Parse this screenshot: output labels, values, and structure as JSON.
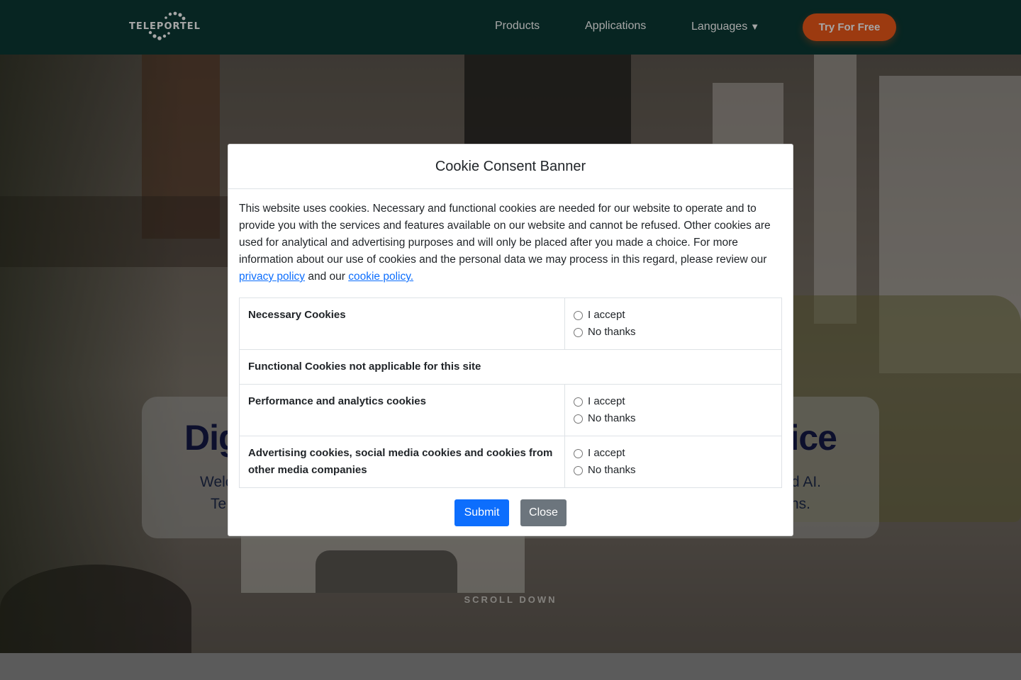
{
  "header": {
    "logo_text": "TELEPORTEL",
    "nav": {
      "products": "Products",
      "applications": "Applications",
      "languages": "Languages",
      "languages_caret": "▼"
    },
    "cta": "Try For Free"
  },
  "hero": {
    "title_left": "Dig",
    "title_right": "ice",
    "line1_left": "Welc",
    "line1_right": "d AI.",
    "line2_left": "Te",
    "line2_right": "ns.",
    "scroll_text": "SCROLL DOWN"
  },
  "modal": {
    "title": "Cookie Consent Banner",
    "intro_text": "This website uses cookies. Necessary and functional cookies are needed for our website to operate and to provide you with the services and features available on our website and cannot be refused. Other cookies are used for analytical and advertising purposes and will only be placed after you made a choice. For more information about our use of cookies and the personal data we may process in this regard, please review our ",
    "privacy_link": "privacy policy",
    "and_text": " and our ",
    "cookie_link": "cookie policy.",
    "rows": [
      {
        "label": "Necessary Cookies",
        "accept": "I accept",
        "decline": "No thanks"
      },
      {
        "label": "Functional Cookies not applicable for this site"
      },
      {
        "label": "Performance and analytics cookies",
        "accept": "I accept",
        "decline": "No thanks"
      },
      {
        "label": "Advertising cookies, social media cookies and cookies from other media companies",
        "accept": "I accept",
        "decline": "No thanks"
      }
    ],
    "submit": "Submit",
    "close": "Close"
  }
}
